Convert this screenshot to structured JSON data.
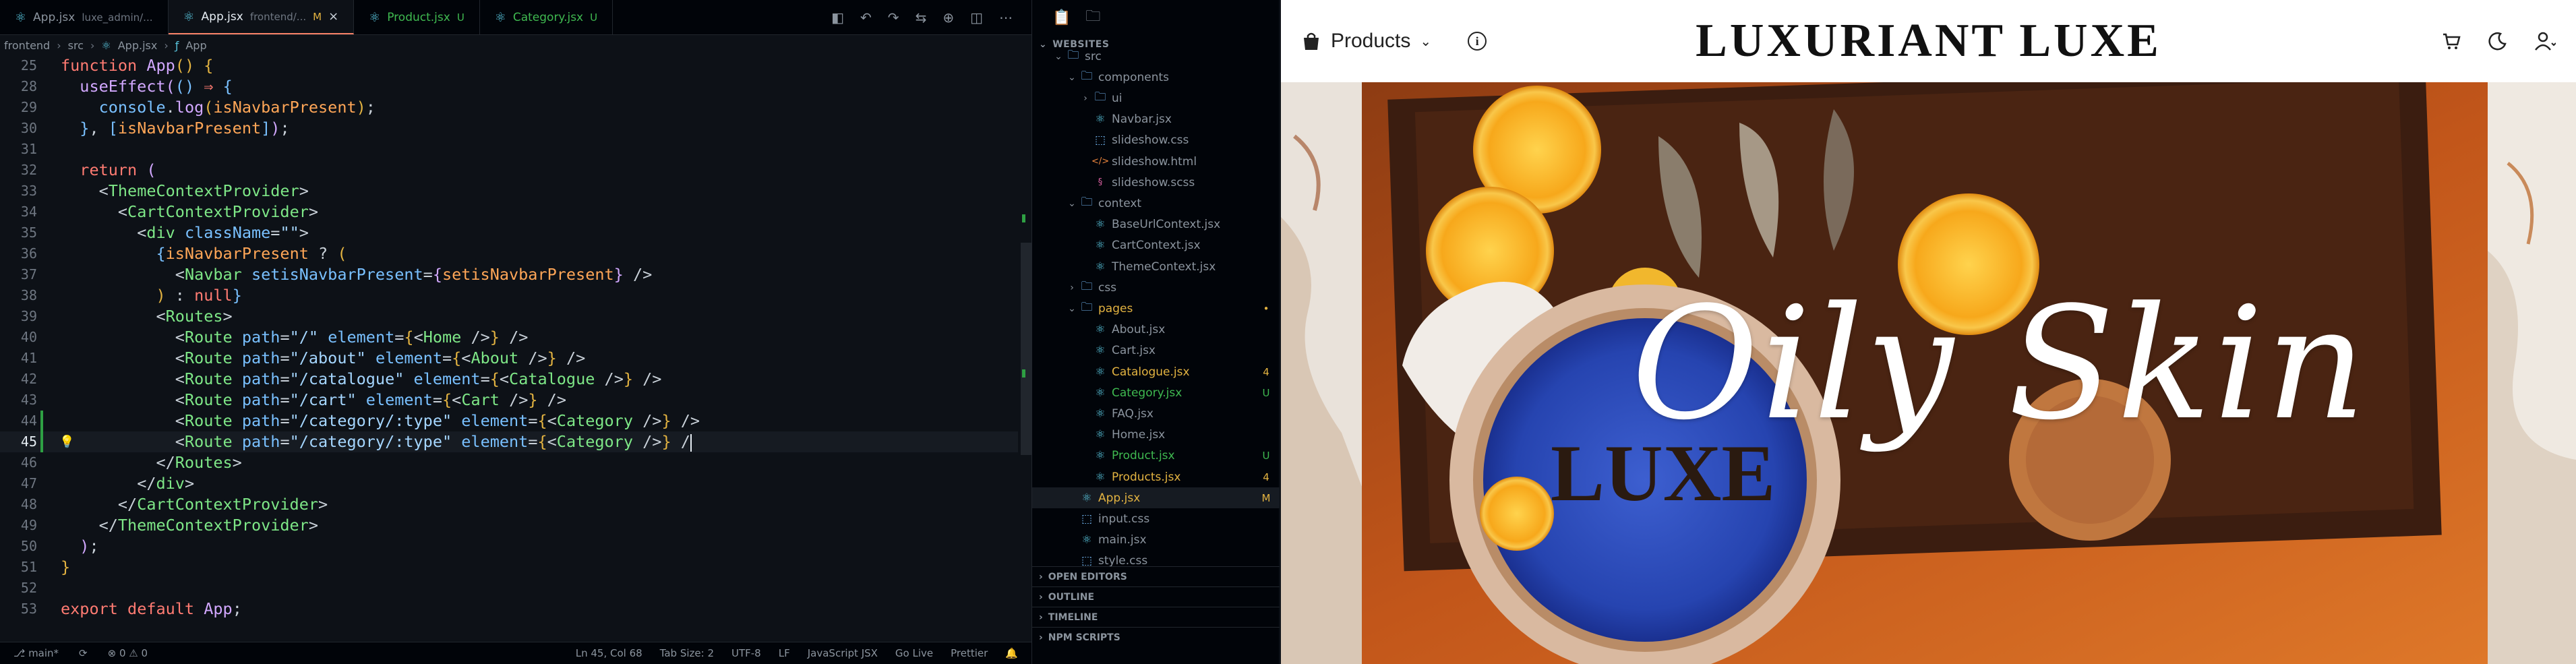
{
  "editor": {
    "tabs": [
      {
        "label": "App.jsx",
        "desc": "luxe_admin/...",
        "status": "",
        "active": false
      },
      {
        "label": "App.jsx",
        "desc": "frontend/...",
        "status": "M",
        "active": true
      },
      {
        "label": "Product.jsx",
        "desc": "",
        "status": "U",
        "active": false
      },
      {
        "label": "Category.jsx",
        "desc": "",
        "status": "U",
        "active": false
      }
    ],
    "breadcrumb": [
      "frontend",
      "src",
      "App.jsx",
      "App"
    ],
    "current_line": 45,
    "status": {
      "branch": "main*",
      "position": "Ln 45, Col 68",
      "spaces": "Tab Size: 2",
      "encoding": "UTF-8",
      "eol": "LF",
      "language": "JavaScript JSX",
      "golive": "Go Live",
      "prettier": "Prettier"
    }
  },
  "explorer": {
    "section": "WEBSITES",
    "items": [
      {
        "name": "src",
        "type": "folder",
        "depth": 1,
        "badge": ""
      },
      {
        "name": "components",
        "type": "folder",
        "depth": 2,
        "badge": ""
      },
      {
        "name": "ui",
        "type": "folder",
        "depth": 3,
        "badge": ""
      },
      {
        "name": "Navbar.jsx",
        "type": "react",
        "depth": 3,
        "badge": ""
      },
      {
        "name": "slideshow.css",
        "type": "css",
        "depth": 3,
        "badge": ""
      },
      {
        "name": "slideshow.html",
        "type": "html",
        "depth": 3,
        "badge": ""
      },
      {
        "name": "slideshow.scss",
        "type": "scss",
        "depth": 3,
        "badge": ""
      },
      {
        "name": "context",
        "type": "folder",
        "depth": 2,
        "badge": ""
      },
      {
        "name": "BaseUrlContext.jsx",
        "type": "react",
        "depth": 3,
        "badge": ""
      },
      {
        "name": "CartContext.jsx",
        "type": "react",
        "depth": 3,
        "badge": ""
      },
      {
        "name": "ThemeContext.jsx",
        "type": "react",
        "depth": 3,
        "badge": ""
      },
      {
        "name": "css",
        "type": "folder",
        "depth": 2,
        "badge": ""
      },
      {
        "name": "pages",
        "type": "folder",
        "depth": 2,
        "badge": "•"
      },
      {
        "name": "About.jsx",
        "type": "react",
        "depth": 3,
        "badge": ""
      },
      {
        "name": "Cart.jsx",
        "type": "react",
        "depth": 3,
        "badge": ""
      },
      {
        "name": "Catalogue.jsx",
        "type": "react",
        "depth": 3,
        "badge": "4"
      },
      {
        "name": "Category.jsx",
        "type": "react",
        "depth": 3,
        "badge": "U"
      },
      {
        "name": "FAQ.jsx",
        "type": "react",
        "depth": 3,
        "badge": ""
      },
      {
        "name": "Home.jsx",
        "type": "react",
        "depth": 3,
        "badge": ""
      },
      {
        "name": "Product.jsx",
        "type": "react",
        "depth": 3,
        "badge": "U"
      },
      {
        "name": "Products.jsx",
        "type": "react",
        "depth": 3,
        "badge": "4"
      },
      {
        "name": "App.jsx",
        "type": "react",
        "depth": 2,
        "badge": "M"
      },
      {
        "name": "input.css",
        "type": "css",
        "depth": 2,
        "badge": ""
      },
      {
        "name": "main.jsx",
        "type": "react",
        "depth": 2,
        "badge": ""
      },
      {
        "name": "style.css",
        "type": "css",
        "depth": 2,
        "badge": ""
      }
    ],
    "bottom_sections": [
      "OPEN EDITORS",
      "OUTLINE",
      "TIMELINE",
      "NPM SCRIPTS"
    ]
  },
  "site": {
    "menu_label": "Products",
    "brand": "LUXURIANT LUXE",
    "hero_title": "Oily Skin",
    "jar_label": "LUXE"
  },
  "colors": {
    "editor_bg": "#0d1117",
    "sidebar_bg": "#010409",
    "modified": "#e3b341",
    "untracked": "#3fb950",
    "react": "#58c4dc"
  }
}
